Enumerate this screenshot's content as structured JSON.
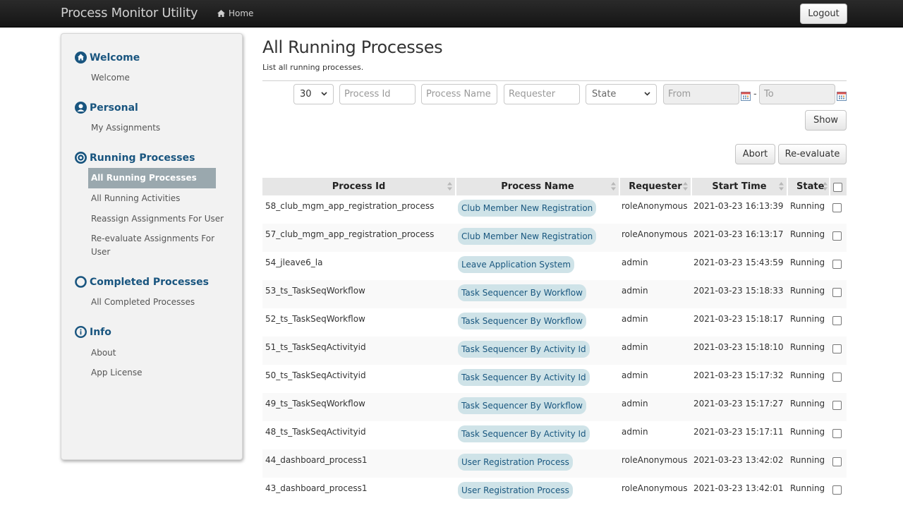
{
  "app": {
    "title": "Process Monitor Utility",
    "home_label": "Home",
    "logout_label": "Logout"
  },
  "sidebar": {
    "sections": [
      {
        "title": "Welcome",
        "icon": "home-circle-icon",
        "links": [
          "Welcome"
        ]
      },
      {
        "title": "Personal",
        "icon": "user-circle-icon",
        "links": [
          "My Assignments"
        ]
      },
      {
        "title": "Running Processes",
        "icon": "clock-circle-icon",
        "links": [
          "All Running Processes",
          "All Running Activities",
          "Reassign Assignments For User",
          "Re-evaluate Assignments For User"
        ]
      },
      {
        "title": "Completed Processes",
        "icon": "ring-icon",
        "links": [
          "All Completed Processes"
        ]
      },
      {
        "title": "Info",
        "icon": "info-circle-icon",
        "links": [
          "About",
          "App License"
        ]
      }
    ],
    "active": "All Running Processes"
  },
  "main": {
    "title": "All Running Processes",
    "description": "List all running processes.",
    "filters": {
      "page_size": "30",
      "process_id_placeholder": "Process Id",
      "process_name_placeholder": "Process Name",
      "requester_placeholder": "Requester",
      "state_value": "State",
      "from_placeholder": "From",
      "to_placeholder": "To",
      "range_separator": "-",
      "show_label": "Show"
    },
    "actions": {
      "abort_label": "Abort",
      "reevaluate_label": "Re-evaluate"
    },
    "table": {
      "columns": [
        "Process Id",
        "Process Name",
        "Requester",
        "Start Time",
        "State"
      ],
      "rows": [
        {
          "id": "58_club_mgm_app_registration_process",
          "name": "Club Member New Registration",
          "requester": "roleAnonymous",
          "start": "2021-03-23 16:13:39",
          "state": "Running"
        },
        {
          "id": "57_club_mgm_app_registration_process",
          "name": "Club Member New Registration",
          "requester": "roleAnonymous",
          "start": "2021-03-23 16:13:17",
          "state": "Running"
        },
        {
          "id": "54_jleave6_la",
          "name": "Leave Application System",
          "requester": "admin",
          "start": "2021-03-23 15:43:59",
          "state": "Running"
        },
        {
          "id": "53_ts_TaskSeqWorkflow",
          "name": "Task Sequencer By Workflow",
          "requester": "admin",
          "start": "2021-03-23 15:18:33",
          "state": "Running"
        },
        {
          "id": "52_ts_TaskSeqWorkflow",
          "name": "Task Sequencer By Workflow",
          "requester": "admin",
          "start": "2021-03-23 15:18:17",
          "state": "Running"
        },
        {
          "id": "51_ts_TaskSeqActivityid",
          "name": "Task Sequencer By Activity Id",
          "requester": "admin",
          "start": "2021-03-23 15:18:10",
          "state": "Running"
        },
        {
          "id": "50_ts_TaskSeqActivityid",
          "name": "Task Sequencer By Activity Id",
          "requester": "admin",
          "start": "2021-03-23 15:17:32",
          "state": "Running"
        },
        {
          "id": "49_ts_TaskSeqWorkflow",
          "name": "Task Sequencer By Workflow",
          "requester": "admin",
          "start": "2021-03-23 15:17:27",
          "state": "Running"
        },
        {
          "id": "48_ts_TaskSeqActivityid",
          "name": "Task Sequencer By Activity Id",
          "requester": "admin",
          "start": "2021-03-23 15:17:11",
          "state": "Running"
        },
        {
          "id": "44_dashboard_process1",
          "name": "User Registration Process",
          "requester": "roleAnonymous",
          "start": "2021-03-23 13:42:02",
          "state": "Running"
        },
        {
          "id": "43_dashboard_process1",
          "name": "User Registration Process",
          "requester": "roleAnonymous",
          "start": "2021-03-23 13:42:01",
          "state": "Running"
        }
      ]
    }
  },
  "colors": {
    "navbar": "#1c1c1c",
    "heading_blue": "#19557f",
    "pill_bg": "#cfe3e8",
    "active_item": "#9aa8ae"
  }
}
